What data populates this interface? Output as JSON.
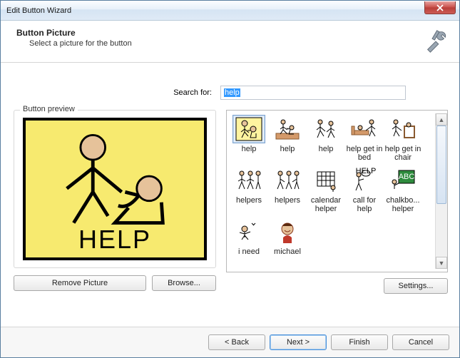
{
  "title": "Edit Button Wizard",
  "header": {
    "title": "Button Picture",
    "subtitle": "Select a picture for the button"
  },
  "search": {
    "label": "Search for:",
    "value": "help"
  },
  "preview": {
    "legend": "Button preview",
    "caption": "HELP"
  },
  "left_buttons": {
    "remove": "Remove Picture",
    "browse": "Browse..."
  },
  "grid": {
    "items": [
      {
        "label": "help",
        "selected": true
      },
      {
        "label": "help"
      },
      {
        "label": "help"
      },
      {
        "label": "help get in bed"
      },
      {
        "label": "help get in chair"
      },
      {
        "label": "helpers"
      },
      {
        "label": "helpers"
      },
      {
        "label": "calendar helper"
      },
      {
        "label": "call for help"
      },
      {
        "label": "chalkbo... helper"
      },
      {
        "label": "i need"
      },
      {
        "label": "michael"
      }
    ],
    "settings": "Settings..."
  },
  "footer": {
    "back": "< Back",
    "next": "Next >",
    "finish": "Finish",
    "cancel": "Cancel"
  }
}
